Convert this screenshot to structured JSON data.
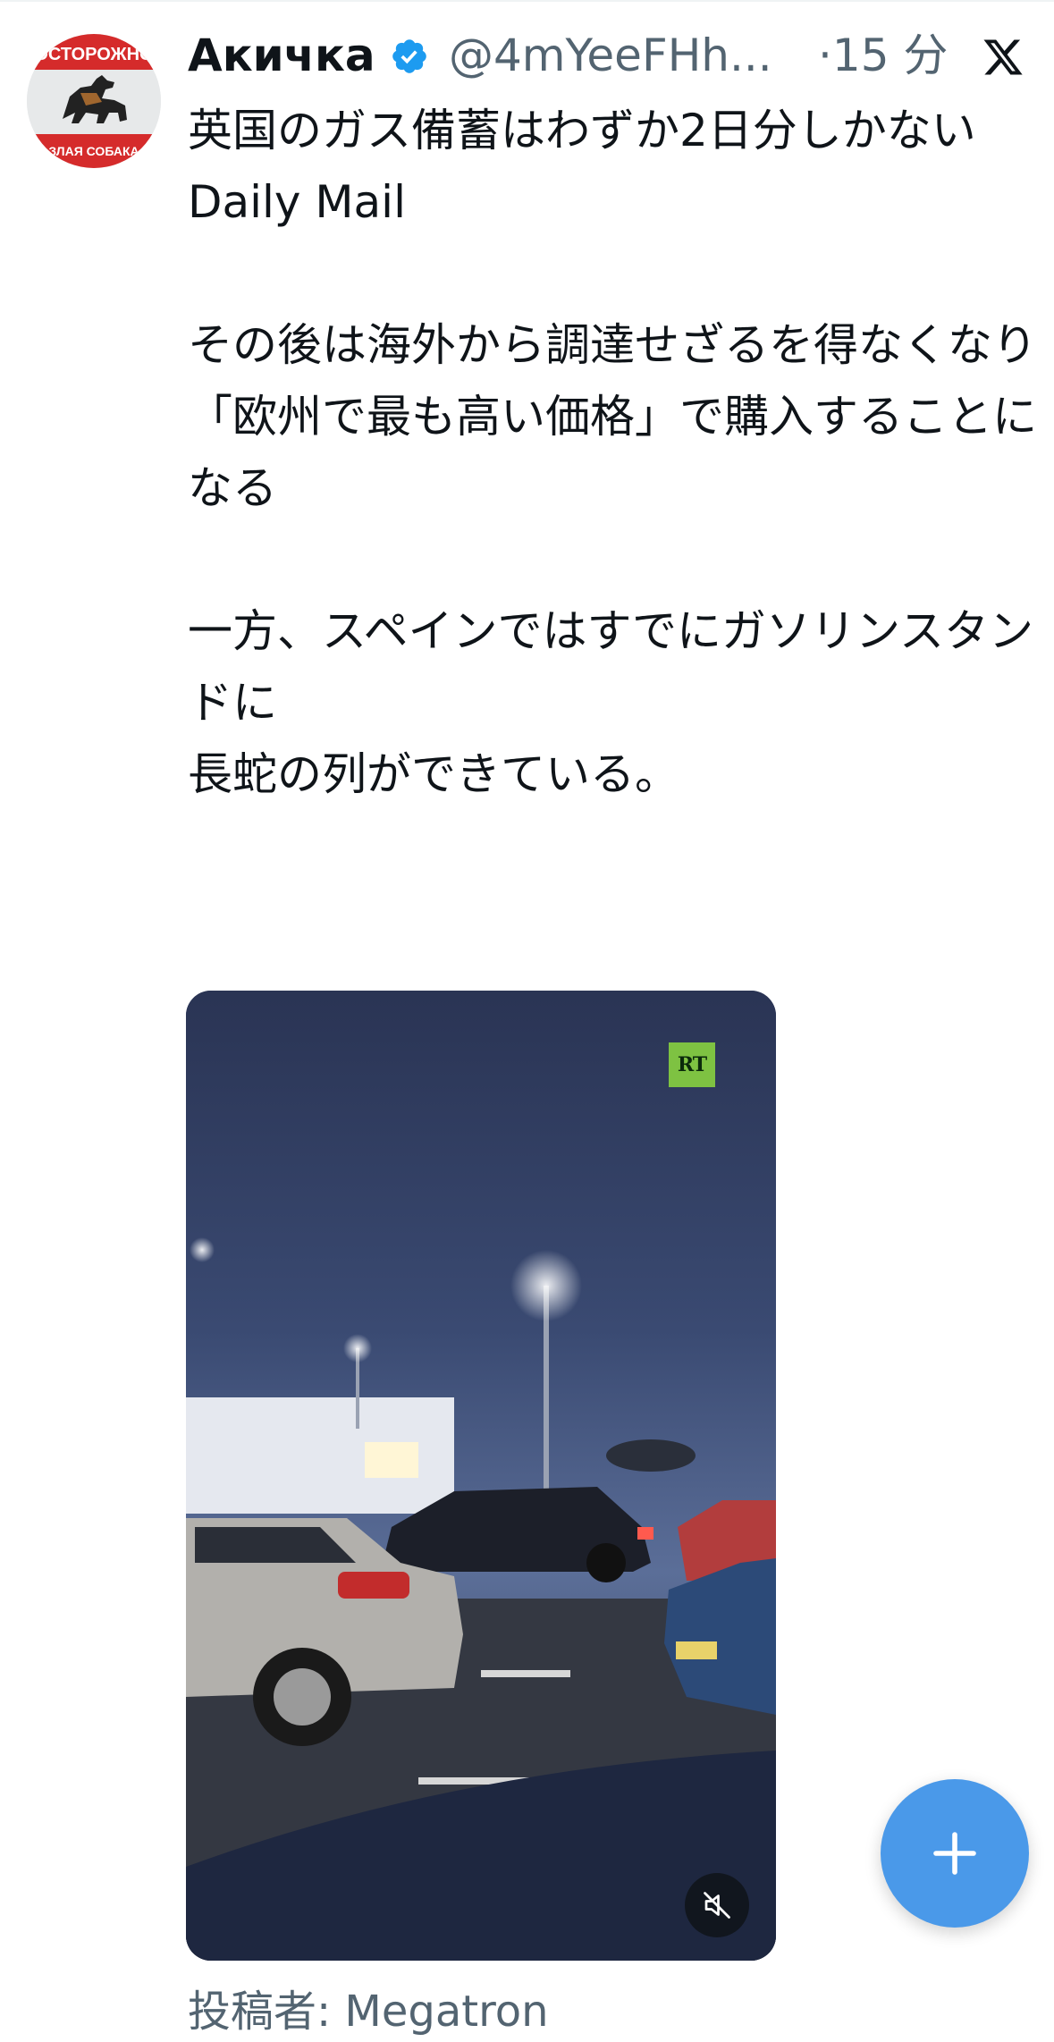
{
  "tweet": {
    "author": {
      "name": "Акичка",
      "handle": "@4mYeeFHh...",
      "verified": true,
      "avatar_text_top": "ОСТОРОЖНО",
      "avatar_text_bottom": "ЗЛАЯ СОБАКА"
    },
    "separator": "·",
    "time": "15 分",
    "text": "英国のガス備蓄はわずか2日分しかない\n Daily Mail\n\nその後は海外から調達せざるを得なくなり\n「欧州で最も高い価格」で購入することになる\n\n一方、スペインではすでにガソリンスタンドに\n長蛇の列ができている。",
    "media": {
      "type": "video",
      "badge": "RT",
      "muted": true
    },
    "attribution": "投稿者: Megatron"
  },
  "icons": {
    "platform": "x-logo-icon",
    "verified": "verified-badge-icon",
    "mute": "speaker-muted-icon",
    "compose": "plus-icon"
  },
  "colors": {
    "text_primary": "#0f1419",
    "text_secondary": "#536471",
    "verified_blue": "#1d9bf0",
    "fab_blue": "#4a99e9",
    "rt_green": "#7ec242"
  }
}
